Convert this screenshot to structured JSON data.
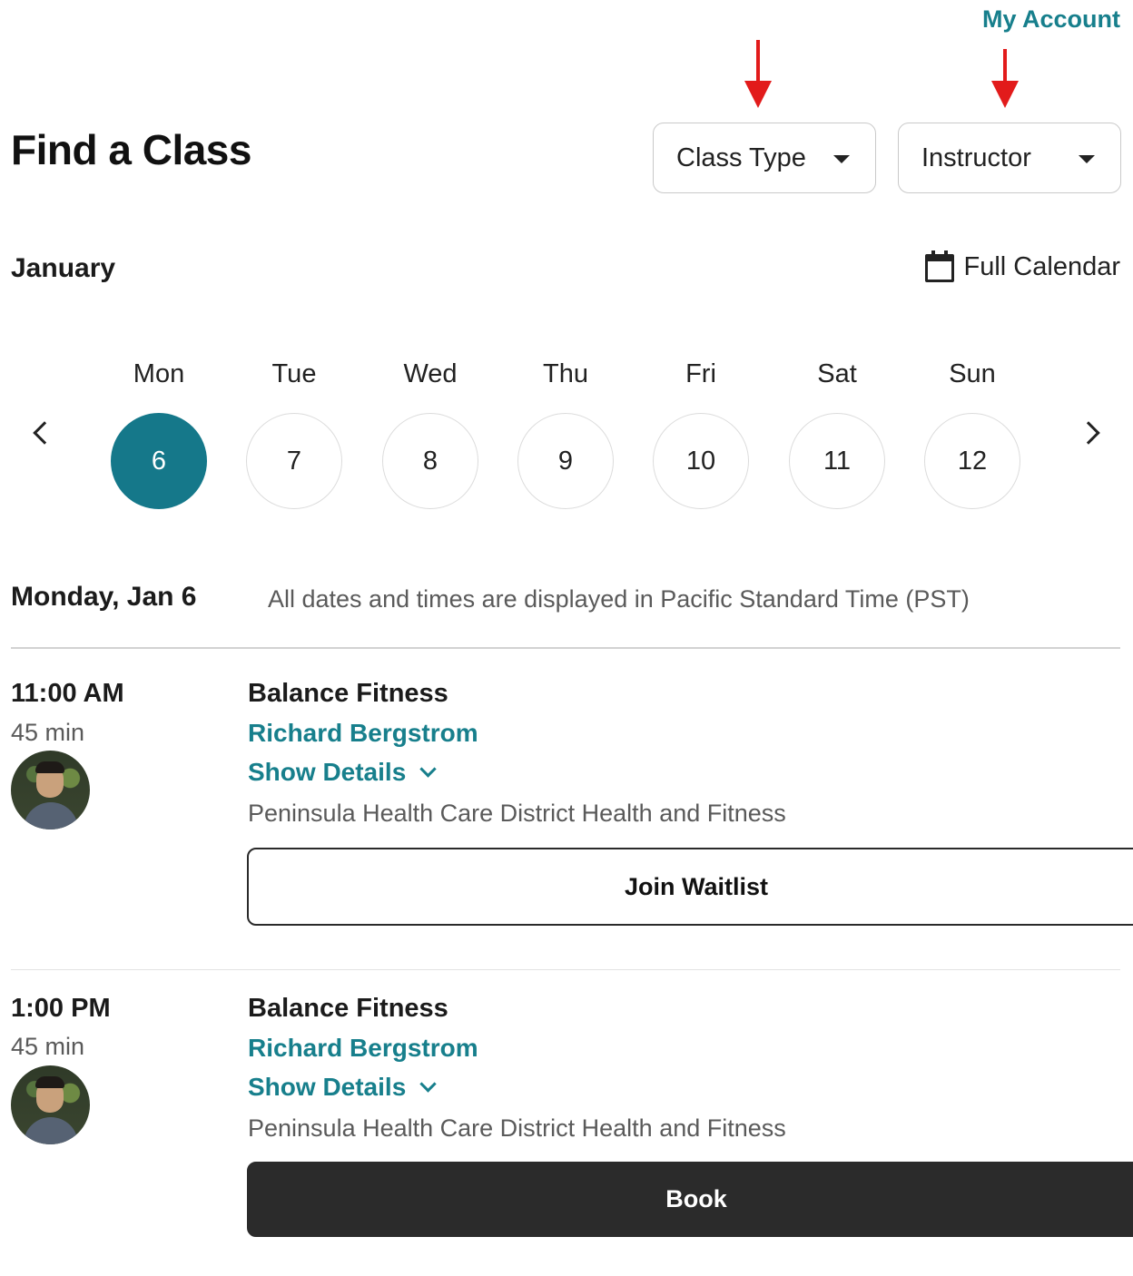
{
  "header": {
    "account_link": "My Account",
    "title": "Find a Class"
  },
  "filters": {
    "class_type": "Class Type",
    "instructor": "Instructor"
  },
  "calendar": {
    "month": "January",
    "full_calendar_label": "Full Calendar",
    "days": [
      {
        "name": "Mon",
        "date": "6",
        "selected": true
      },
      {
        "name": "Tue",
        "date": "7"
      },
      {
        "name": "Wed",
        "date": "8"
      },
      {
        "name": "Thu",
        "date": "9"
      },
      {
        "name": "Fri",
        "date": "10"
      },
      {
        "name": "Sat",
        "date": "11"
      },
      {
        "name": "Sun",
        "date": "12"
      }
    ]
  },
  "schedule": {
    "date_label": "Monday, Jan 6",
    "timezone_note": "All dates and times are displayed in Pacific Standard Time (PST)",
    "classes": [
      {
        "time": "11:00 AM",
        "duration": "45 min",
        "name": "Balance Fitness",
        "instructor": "Richard Bergstrom",
        "details_label": "Show Details",
        "location": "Peninsula Health Care District Health and Fitness",
        "action": "Join Waitlist"
      },
      {
        "time": "1:00 PM",
        "duration": "45 min",
        "name": "Balance Fitness",
        "instructor": "Richard Bergstrom",
        "details_label": "Show Details",
        "location": "Peninsula Health Care District Health and Fitness",
        "action": "Book"
      }
    ]
  },
  "colors": {
    "accent": "#177f8c",
    "selected_day": "#15788a",
    "annotation_arrow": "#e21b1b",
    "primary_button": "#2b2b2b"
  }
}
